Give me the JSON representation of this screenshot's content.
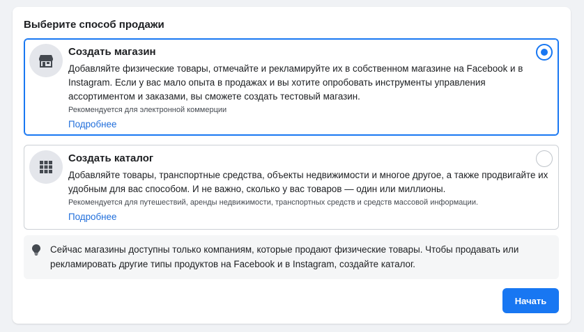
{
  "heading": "Выберите способ продажи",
  "options": [
    {
      "title": "Создать магазин",
      "icon": "storefront-icon",
      "description": "Добавляйте физические товары, отмечайте и рекламируйте их в собственном магазине на Facebook и в Instagram. Если у вас мало опыта в продажах и вы хотите опробовать инструменты управления ассортиментом и заказами, вы сможете создать тестовый магазин.",
      "recommendation": "Рекомендуется для электронной коммерции",
      "link": "Подробнее",
      "selected": true
    },
    {
      "title": "Создать каталог",
      "icon": "grid-icon",
      "description": "Добавляйте товары, транспортные средства, объекты недвижимости и многое другое, а также продвигайте их удобным для вас способом. И не важно, сколько у вас товаров — один или миллионы.",
      "recommendation": "Рекомендуется для путешествий, аренды недвижимости, транспортных средств и средств массовой информации.",
      "link": "Подробнее",
      "selected": false
    }
  ],
  "notice": {
    "icon": "lightbulb-icon",
    "text": "Сейчас магазины доступны только компаниям, которые продают физические товары. Чтобы продавать или рекламировать другие типы продуктов на Facebook и в Instagram, создайте каталог."
  },
  "start_button": "Начать",
  "colors": {
    "accent": "#1877f2",
    "link": "#216fdb",
    "background": "#f0f2f5"
  }
}
